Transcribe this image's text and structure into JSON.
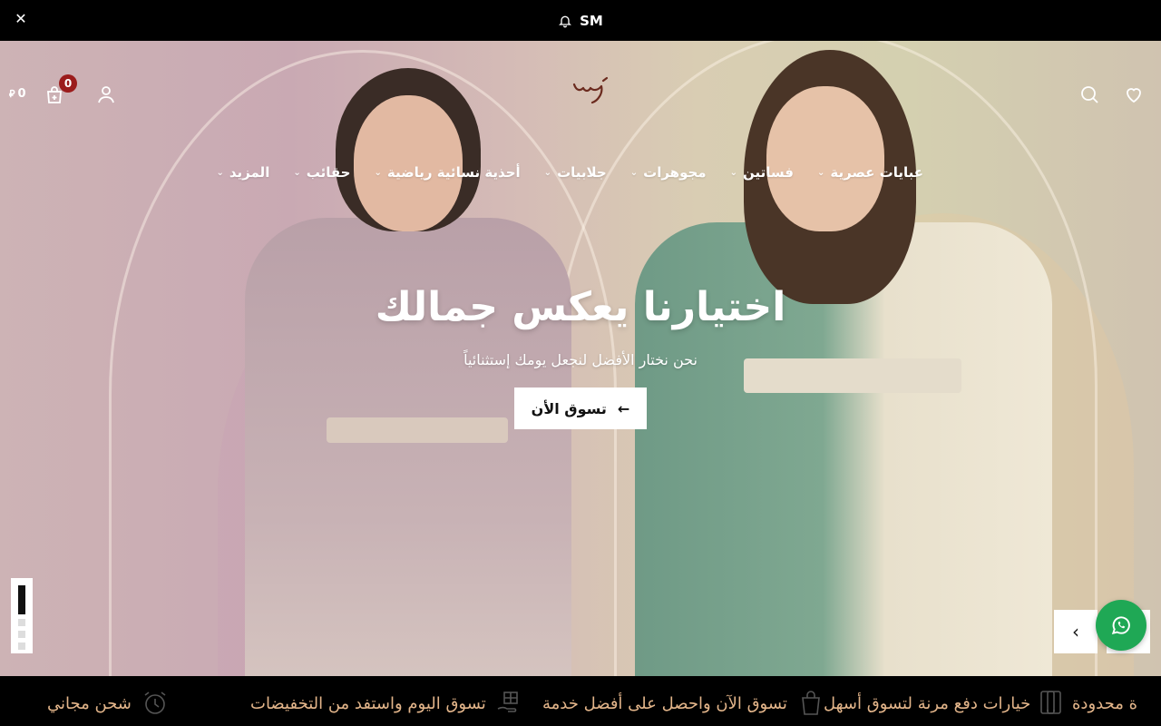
{
  "announcement": {
    "text": "SM",
    "icon": "bell-icon"
  },
  "header": {
    "cart_count": "0",
    "cart_total": "0",
    "currency_symbol": "⃁"
  },
  "nav": {
    "items": [
      {
        "label": "عبايات عصرية",
        "has_dropdown": true
      },
      {
        "label": "فساتين",
        "has_dropdown": true
      },
      {
        "label": "مجوهرات",
        "has_dropdown": true
      },
      {
        "label": "جلابيات",
        "has_dropdown": true
      },
      {
        "label": "أحذية نسائية رياضية",
        "has_dropdown": true
      },
      {
        "label": "حقائب",
        "has_dropdown": true
      },
      {
        "label": "المزيد",
        "has_dropdown": true
      }
    ]
  },
  "hero": {
    "title": "اختيارنا يعكس جمالك",
    "subtitle": "نحن نختار الأفضل لنجعل يومك إستثنائياً",
    "cta_label": "تسوق الأن"
  },
  "features": {
    "items": [
      {
        "label": "ة محدودة",
        "icon": "clock-icon"
      },
      {
        "label": "خيارات دفع مرنة لتسوق أسهل",
        "icon": "phone-payment-icon"
      },
      {
        "label": "تسوق الآن واحصل على أفضل خدمة",
        "icon": "shopping-bag-icon"
      },
      {
        "label": "تسوق اليوم واستفد من التخفيضات",
        "icon": "gift-hand-icon"
      },
      {
        "label": "شحن مجاني",
        "icon": "alarm-clock-icon"
      }
    ]
  },
  "colors": {
    "accent": "#e3b58a",
    "badge": "#9b1c1c",
    "whatsapp": "#1fa855"
  }
}
